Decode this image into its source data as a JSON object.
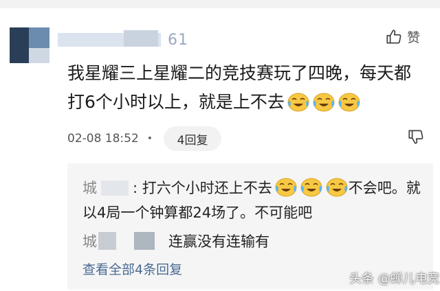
{
  "comment": {
    "username_visible": "61",
    "like_label": "赞",
    "text_line1": "我星耀三上星耀二的竞技赛玩了四晚，每天都",
    "text_line2": "打6个小时以上，就是上不去",
    "emoji_count": 3,
    "emoji_name": "crying-laughing-emoji",
    "timestamp": "02-08 18:52",
    "more_symbol": "•",
    "reply_count_label": "4回复"
  },
  "replies": {
    "reply1_name_visible": "城",
    "reply1_text_a": ": 打六个小时还上不去",
    "reply1_text_b": "不会吧。就以4局一个钟算都24场了。不可能吧",
    "reply2_name_visible": "城",
    "reply2_text": "连赢没有连输有",
    "view_all_label": "查看全部4条回复"
  },
  "watermark": {
    "text": "头条 @蝉儿电竞"
  },
  "colors": {
    "link": "#4a6a94",
    "reply_bg": "#f5f5f5",
    "button_bg": "#f2f2f2"
  }
}
